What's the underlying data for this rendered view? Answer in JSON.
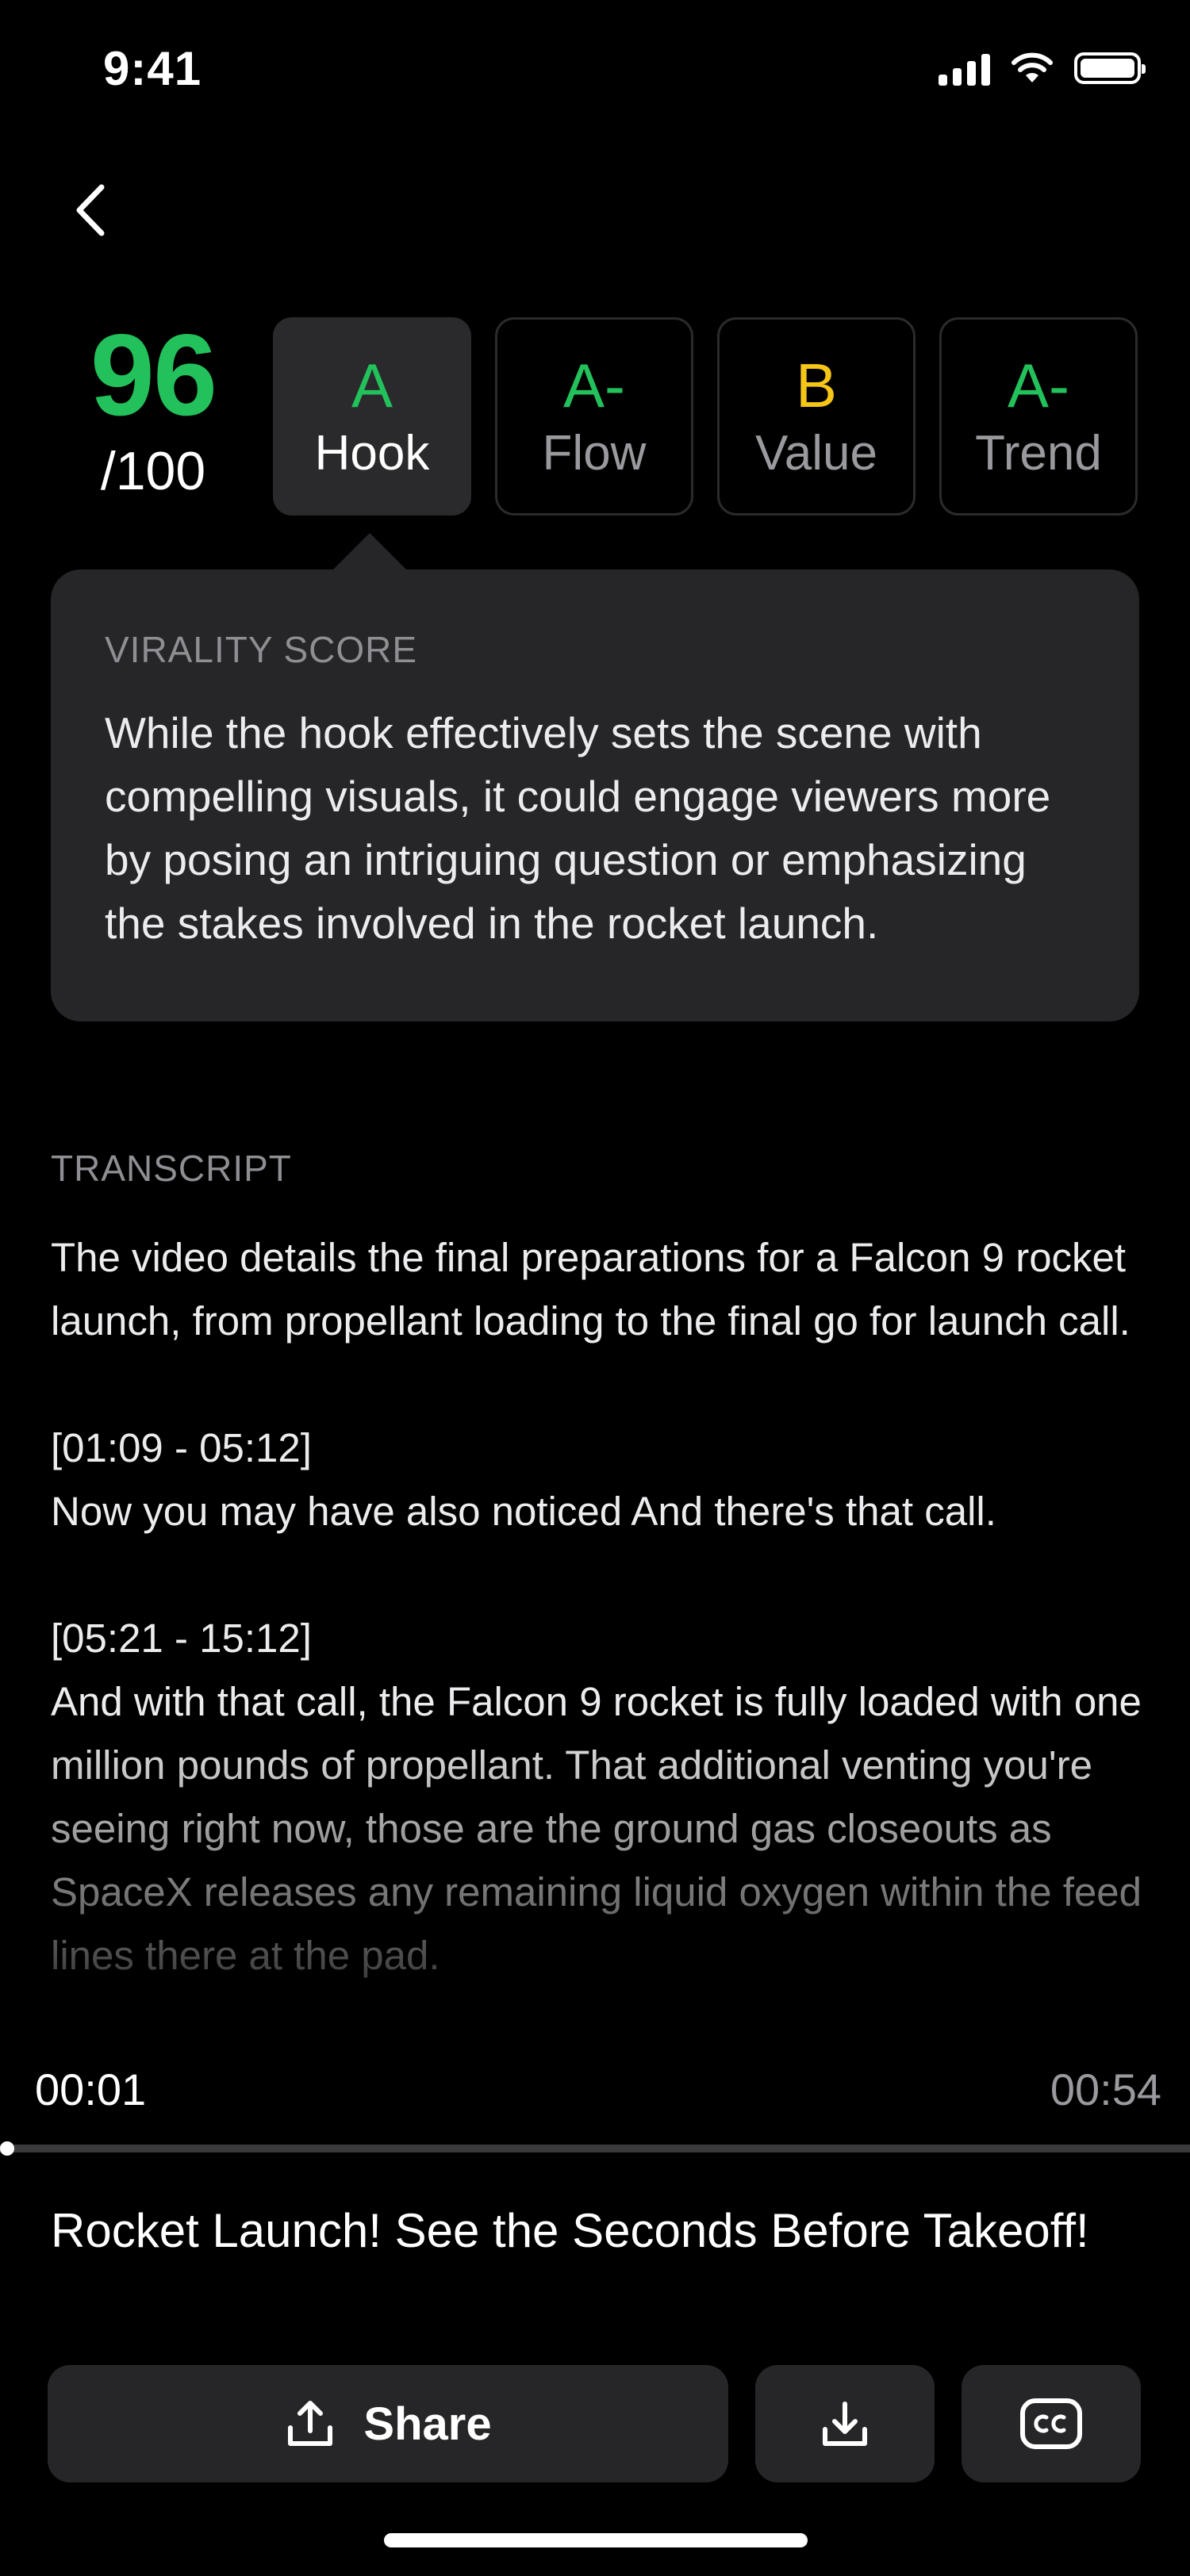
{
  "status_bar": {
    "time": "9:41"
  },
  "score": {
    "value": "96",
    "denominator": "/100"
  },
  "grades": [
    {
      "letter": "A",
      "label": "Hook",
      "color": "#23c15b",
      "active": true
    },
    {
      "letter": "A-",
      "label": "Flow",
      "color": "#23c15b",
      "active": false
    },
    {
      "letter": "B",
      "label": "Value",
      "color": "#f5c518",
      "active": false
    },
    {
      "letter": "A-",
      "label": "Trend",
      "color": "#23c15b",
      "active": false
    }
  ],
  "info_card": {
    "title": "VIRALITY SCORE",
    "body": "While the hook effectively sets the scene with compelling visuals, it could engage viewers more by posing an intriguing question or emphasizing the stakes involved in the rocket launch."
  },
  "transcript": {
    "label": "TRANSCRIPT",
    "summary": "The video details the final preparations for a Falcon 9 rocket launch, from propellant loading to the final go for launch call.",
    "segments": [
      {
        "range": "[01:09 - 05:12]",
        "text": "Now you may have also noticed And there's that call."
      },
      {
        "range": "[05:21 - 15:12]",
        "text": "And with that call, the Falcon 9 rocket is fully loaded with one million pounds of propellant. That additional venting you're seeing right now, those are the ground gas closeouts as SpaceX releases any remaining liquid oxygen within the feed lines there at the pad."
      }
    ]
  },
  "player": {
    "current_time": "00:01",
    "total_time": "00:54",
    "progress": 0.0
  },
  "video_title": "Rocket Launch! See the Seconds Before Takeoff!",
  "actions": {
    "share_label": "Share",
    "share_icon": "share-icon",
    "download_icon": "download-icon",
    "captions_icon": "closed-captions-icon"
  }
}
